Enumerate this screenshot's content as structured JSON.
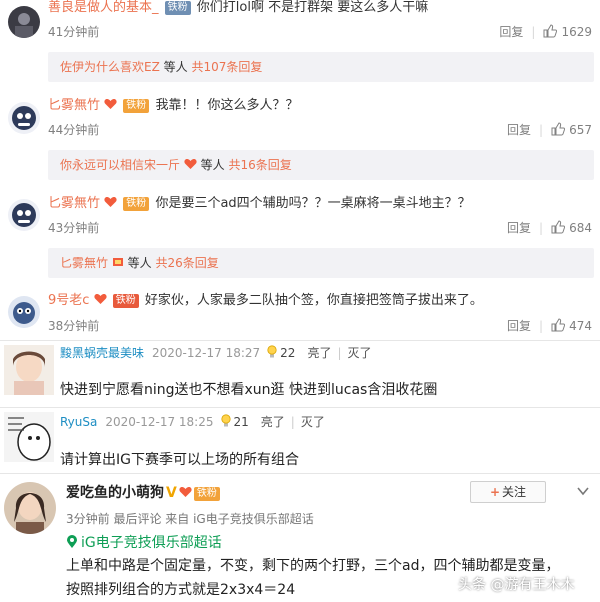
{
  "comments": [
    {
      "username": "善良是做人的基本_",
      "badge": "铁粉",
      "text": "你们打lol啊 不是打群架 要这么多人干嘛",
      "time": "41分钟前",
      "reply_label": "回复",
      "likes": "1629",
      "replies_preview": {
        "who": "佐伊为什么喜欢EZ",
        "deng": "等人",
        "count": "共107条回复"
      }
    },
    {
      "username": "匕雾無竹",
      "badge": "铁粉",
      "text": "我靠！！你这么多人？？",
      "time": "44分钟前",
      "reply_label": "回复",
      "likes": "657",
      "replies_preview": {
        "who": "你永远可以相信宋一斤",
        "deng": "等人",
        "count": "共16条回复"
      }
    },
    {
      "username": "匕雾無竹",
      "badge": "铁粉",
      "text": "你是要三个ad四个辅助吗？？一桌麻将一桌斗地主？？",
      "time": "43分钟前",
      "reply_label": "回复",
      "likes": "684",
      "replies_preview": {
        "who": "匕雾無竹",
        "deng": "等人",
        "count": "共26条回复"
      }
    },
    {
      "username": "9号老c",
      "badge": "铁粉",
      "text": "好家伙，人家最多二队抽个签，你直接把签筒子拔出来了。",
      "time": "38分钟前",
      "reply_label": "回复",
      "likes": "474"
    }
  ],
  "tieba": [
    {
      "name": "黢黑蜗壳最美味",
      "date": "2020-12-17 18:27",
      "count": "22",
      "liang": "亮了",
      "mie": "灭了",
      "text": "快进到宁愿看ning送也不想看xun逛 快进到lucas含泪收花圈"
    },
    {
      "name": "RyuSa",
      "date": "2020-12-17 18:25",
      "count": "21",
      "liang": "亮了",
      "mie": "灭了",
      "text": "请计算出IG下赛季可以上场的所有组合"
    }
  ],
  "post": {
    "author": "爱吃鱼的小萌狗",
    "badge": "铁粉",
    "follow_label": "关注",
    "meta": "3分钟前 最后评论 来自 iG电子竞技俱乐部超话",
    "topic": "iG电子竞技俱乐部超话",
    "line1": "上单和中路是个固定量，不变，剩下的两个打野，三个ad，四个辅助都是变量，",
    "line2": "按照排列组合的方式就是2x3x4＝24"
  },
  "watermark": "头条 @游有王木木",
  "colors": {
    "username": "#eb7350",
    "tieba_name": "#1e8ec3",
    "topic": "#0e9e55"
  }
}
